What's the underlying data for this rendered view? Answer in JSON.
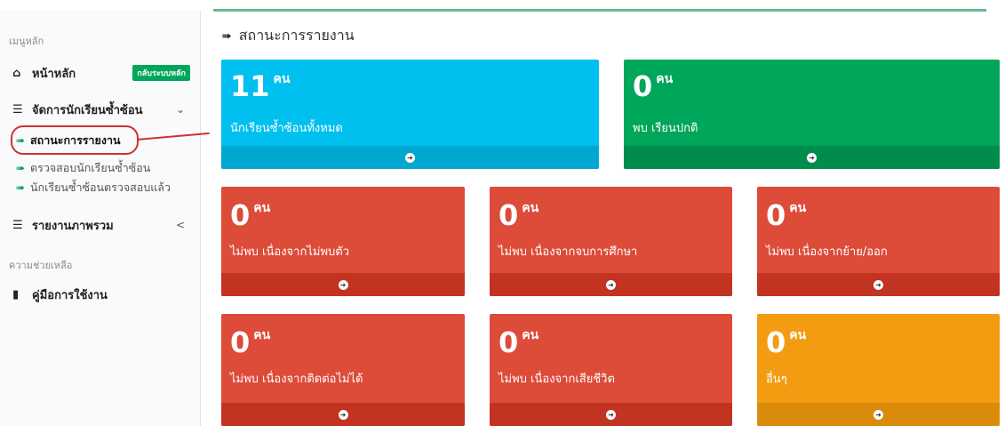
{
  "sidebar": {
    "main_header": "เมนูหลัก",
    "home": {
      "label": "หน้าหลัก",
      "badge": "กลับระบบหลัก"
    },
    "manage": {
      "label": "จัดการนักเรียนซ้ำซ้อน",
      "chevron": "⌄"
    },
    "sub_items": [
      {
        "label": "สถานะการรายงาน",
        "active": true
      },
      {
        "label": "ตรวจสอบนักเรียนซ้ำซ้อน",
        "active": false
      },
      {
        "label": "นักเรียนซ้ำซ้อนตรวจสอบแล้ว",
        "active": false
      }
    ],
    "report": {
      "label": "รายงานภาพรวม",
      "chevron": "<"
    },
    "help_header": "ความช่วยเหลือ",
    "manual": {
      "label": "คู่มือการใช้งาน"
    }
  },
  "page": {
    "title": "สถานะการรายงาน"
  },
  "unit": "คน",
  "boxes": [
    {
      "count": "11",
      "label": "นักเรียนซ้ำซ้อนทั้งหมด",
      "color": "#00c0ef",
      "footer_color": "#00a7d0"
    },
    {
      "count": "0",
      "label": "พบ เรียนปกติ",
      "color": "#00a65a",
      "footer_color": "#008d4c"
    },
    {
      "count": "0",
      "label": "ไม่พบ เนื่องจากไม่พบตัว",
      "color": "#dd4b39",
      "footer_color": "#c23321"
    },
    {
      "count": "0",
      "label": "ไม่พบ เนื่องจากจบการศึกษา",
      "color": "#dd4b39",
      "footer_color": "#c23321"
    },
    {
      "count": "0",
      "label": "ไม่พบ เนื่องจากย้าย/ออก",
      "color": "#dd4b39",
      "footer_color": "#c23321"
    },
    {
      "count": "0",
      "label": "ไม่พบ เนื่องจากติดต่อไม่ได้",
      "color": "#dd4b39",
      "footer_color": "#c23321"
    },
    {
      "count": "0",
      "label": "ไม่พบ เนื่องจากเสียชีวิต",
      "color": "#dd4b39",
      "footer_color": "#c23321"
    },
    {
      "count": "0",
      "label": "อื่นๆ",
      "color": "#f39c12",
      "footer_color": "#db8b0b"
    }
  ],
  "icons": {
    "home": "home-icon",
    "list": "list-icon",
    "sign_in": "sign-in-icon",
    "book": "book-icon",
    "arrow": "arrow-circle-right-icon"
  }
}
